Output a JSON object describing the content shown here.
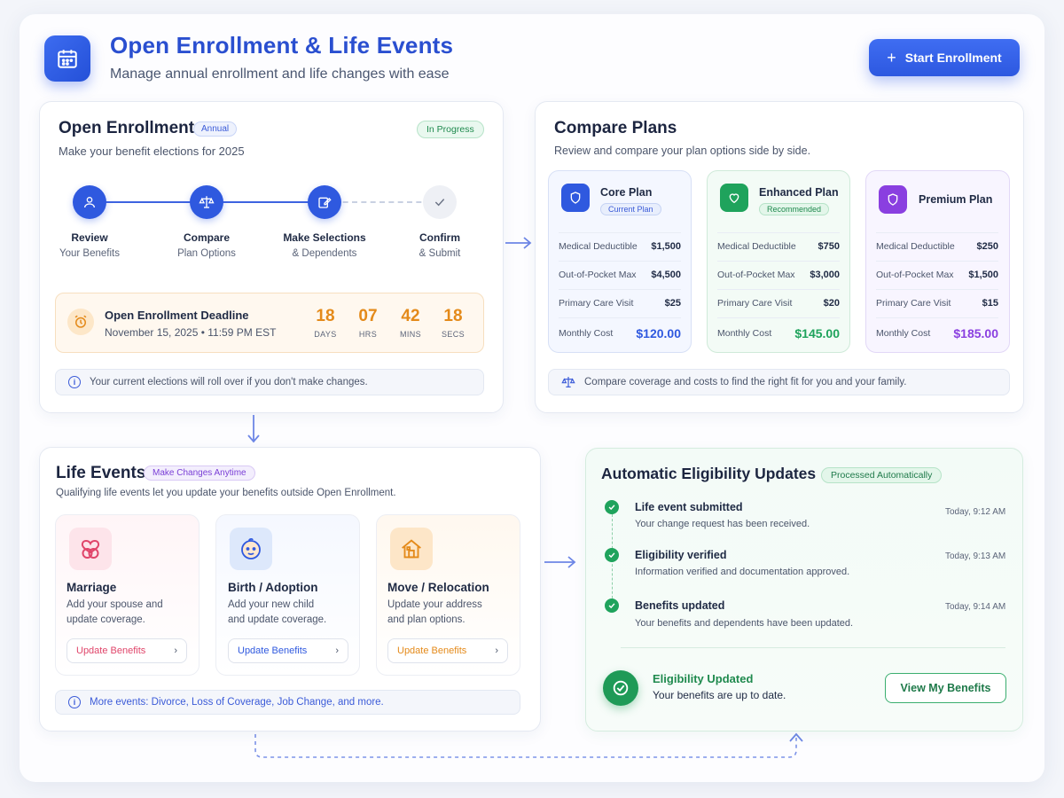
{
  "header": {
    "title": "Open Enrollment & Life Events",
    "subtitle": "Manage annual enrollment and life changes with ease",
    "start_button": "Start Enrollment",
    "app_icon": "calendar-icon"
  },
  "open_enrollment": {
    "title": "Open Enrollment",
    "tag": "Annual",
    "status": "In Progress",
    "subtitle": "Make your benefit elections for 2025",
    "steps": [
      {
        "label": "Review",
        "sub": "Your Benefits",
        "icon": "user-icon"
      },
      {
        "label": "Compare",
        "sub": "Plan Options",
        "icon": "scale-icon"
      },
      {
        "label": "Make Selections",
        "sub": "& Dependents",
        "icon": "edit-icon"
      },
      {
        "label": "Confirm",
        "sub": "& Submit",
        "icon": "check-icon"
      }
    ],
    "deadline": {
      "title": "Open Enrollment Deadline",
      "date": "November 15, 2025 • 11:59 PM EST",
      "countdown": [
        {
          "value": "18",
          "unit": "DAYS"
        },
        {
          "value": "07",
          "unit": "HRS"
        },
        {
          "value": "42",
          "unit": "MINS"
        },
        {
          "value": "18",
          "unit": "SECS"
        }
      ]
    },
    "info": "Your current elections will roll over if you don't make changes."
  },
  "compare": {
    "title": "Compare Plans",
    "subtitle": "Review and compare your plan options side by side.",
    "plans": [
      {
        "name": "Core Plan",
        "badge": "Current Plan",
        "color": "#2f59df",
        "rows": [
          [
            "Medical Deductible",
            "$1,500"
          ],
          [
            "Out-of-Pocket Max",
            "$4,500"
          ],
          [
            "Primary Care Visit",
            "$25"
          ]
        ],
        "cost_label": "Monthly Cost",
        "cost": "$120.00"
      },
      {
        "name": "Enhanced Plan",
        "badge": "Recommended",
        "color": "#1fa35c",
        "rows": [
          [
            "Medical Deductible",
            "$750"
          ],
          [
            "Out-of-Pocket Max",
            "$3,000"
          ],
          [
            "Primary Care Visit",
            "$20"
          ]
        ],
        "cost_label": "Monthly Cost",
        "cost": "$145.00"
      },
      {
        "name": "Premium Plan",
        "badge": "",
        "color": "#8a3fe0",
        "rows": [
          [
            "Medical Deductible",
            "$250"
          ],
          [
            "Out-of-Pocket Max",
            "$1,500"
          ],
          [
            "Primary Care Visit",
            "$15"
          ]
        ],
        "cost_label": "Monthly Cost",
        "cost": "$185.00"
      }
    ],
    "info": "Compare coverage and costs to find the right fit for you and your family."
  },
  "life_events": {
    "title": "Life Events",
    "tag": "Make Changes Anytime",
    "subtitle": "Qualifying life events let you update your benefits outside Open Enrollment.",
    "events": [
      {
        "name": "Marriage",
        "desc1": "Add your spouse and",
        "desc2": "update coverage.",
        "button": "Update Benefits",
        "color": "#e0456a"
      },
      {
        "name": "Birth / Adoption",
        "desc1": "Add your new child",
        "desc2": "and update coverage.",
        "button": "Update Benefits",
        "color": "#2f59df"
      },
      {
        "name": "Move / Relocation",
        "desc1": "Update your address",
        "desc2": "and plan options.",
        "button": "Update Benefits",
        "color": "#e48a1a"
      }
    ],
    "info": "More events: Divorce, Loss of Coverage, Job Change, and more."
  },
  "eligibility": {
    "title": "Automatic Eligibility Updates",
    "tag": "Processed Automatically",
    "timeline": [
      {
        "title": "Life event submitted",
        "sub": "Your change request has been received.",
        "time": "Today, 9:12 AM"
      },
      {
        "title": "Eligibility verified",
        "sub": "Information verified and documentation approved.",
        "time": "Today, 9:13 AM"
      },
      {
        "title": "Benefits updated",
        "sub": "Your benefits and dependents have been updated.",
        "time": "Today, 9:14 AM"
      }
    ],
    "result_title": "Eligibility Updated",
    "result_sub": "Your benefits are up to date.",
    "view_button": "View My Benefits"
  }
}
